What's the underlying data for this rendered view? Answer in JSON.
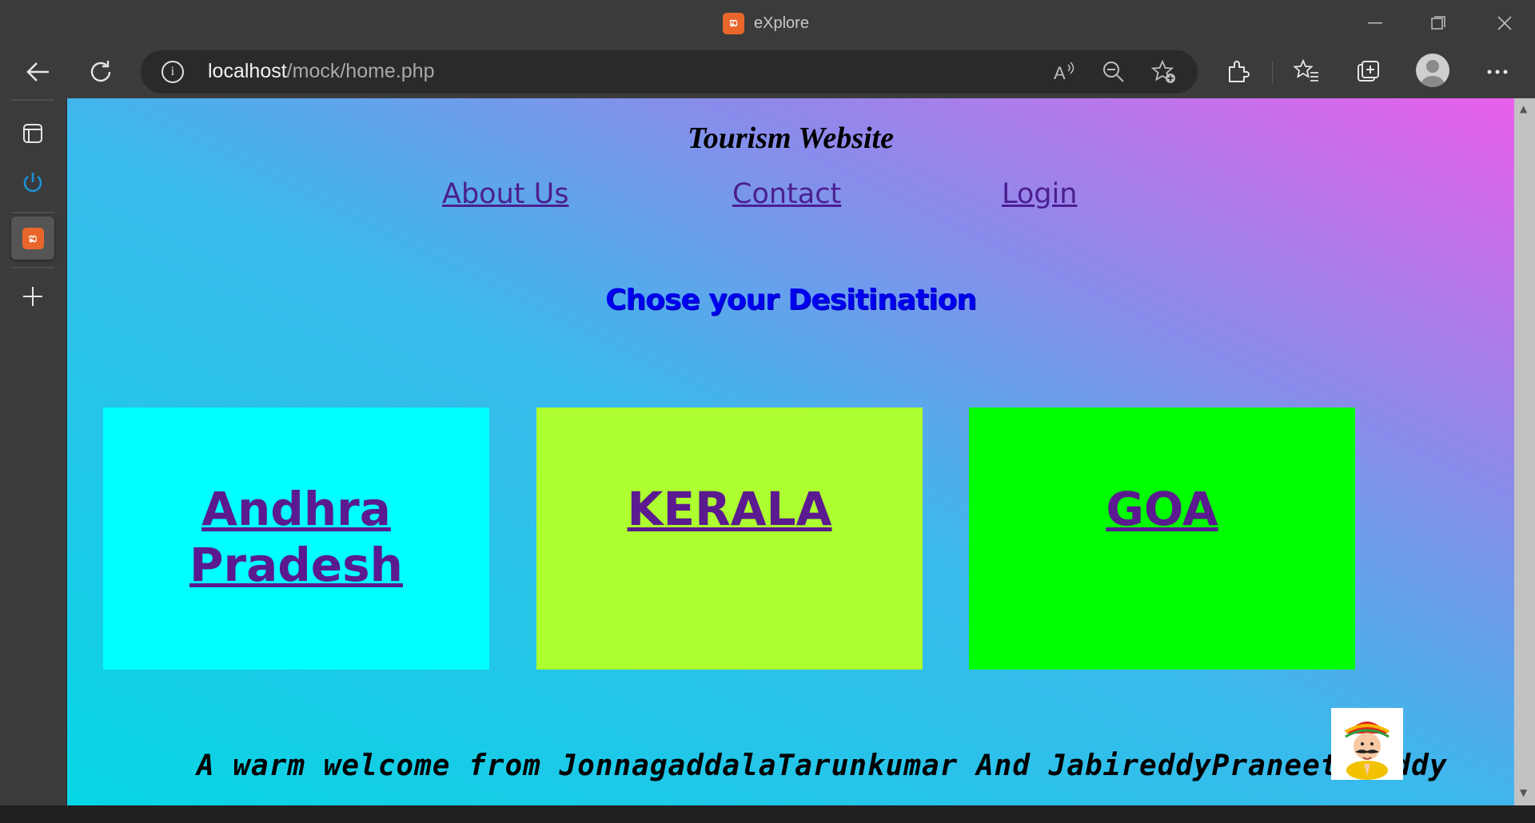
{
  "window": {
    "title": "eXplore",
    "app_logo_glyph": "ಐ"
  },
  "toolbar": {
    "url_host": "localhost",
    "url_path": "/mock/home.php"
  },
  "site": {
    "title": "Tourism Website",
    "nav": [
      {
        "label": "About Us"
      },
      {
        "label": "Contact"
      },
      {
        "label": "Login"
      }
    ],
    "subheading": "Chose your Desitination",
    "cards": [
      {
        "label": "Andhra Pradesh",
        "color": "#00ffff"
      },
      {
        "label": "KERALA",
        "color": "#adff2f"
      },
      {
        "label": "GOA",
        "color": "#00ff00"
      }
    ],
    "welcome": "A warm welcome from JonnagaddalaTarunkumar And JabireddyPraneethReddy"
  },
  "colors": {
    "link": "#5b1a8f",
    "subheading": "#0000ee",
    "gradient_start": "#06d6e4",
    "gradient_end": "#e95fec"
  },
  "icons": [
    "back-icon",
    "refresh-icon",
    "info-icon",
    "read-aloud-icon",
    "zoom-out-icon",
    "add-favorite-icon",
    "extensions-icon",
    "favorites-icon",
    "collections-icon",
    "profile-icon",
    "more-icon",
    "tab-actions-icon",
    "power-icon",
    "xampp-icon",
    "add-icon"
  ]
}
